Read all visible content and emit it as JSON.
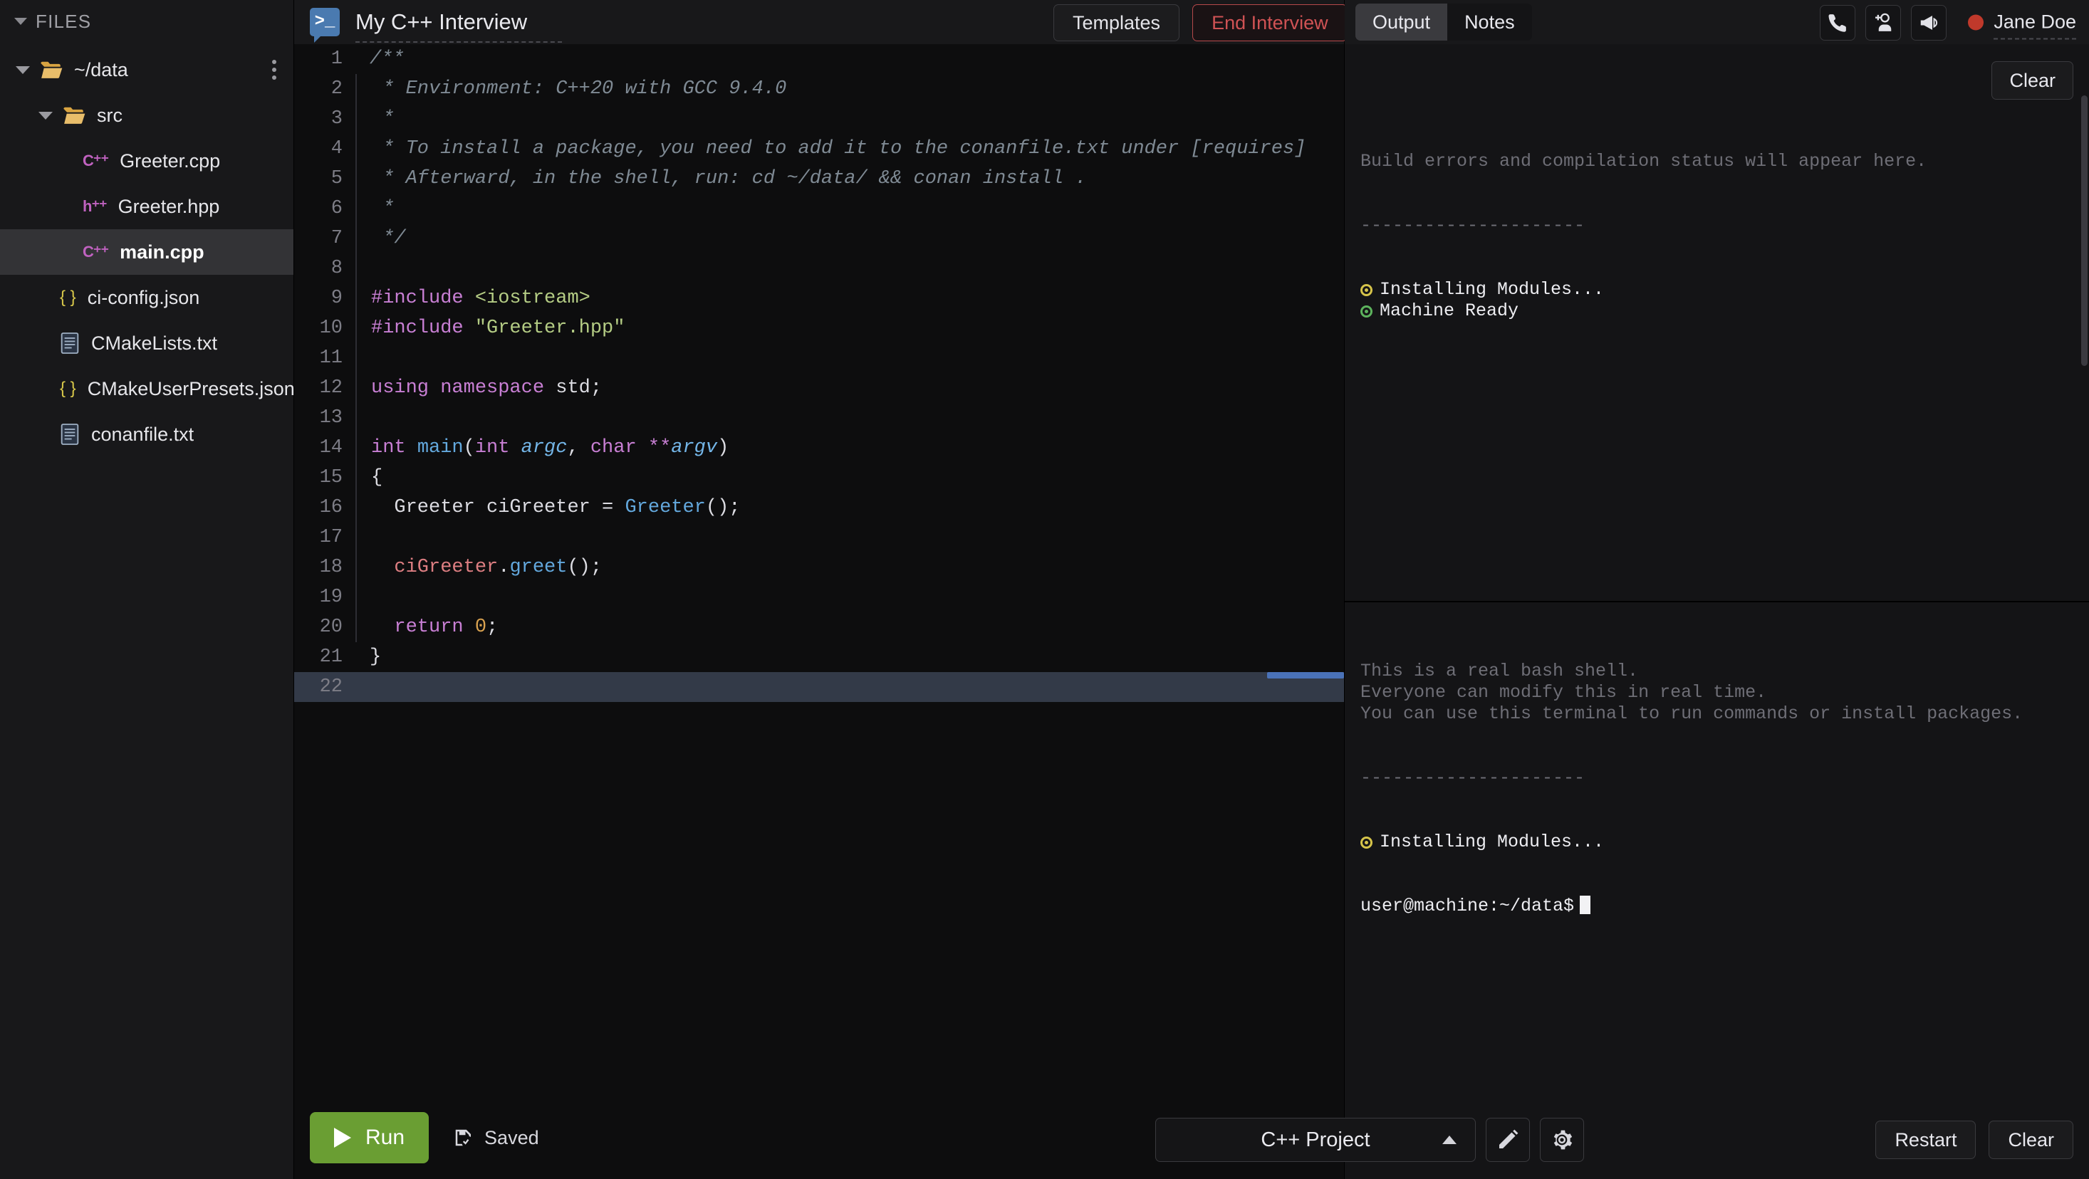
{
  "sidebar": {
    "header": "FILES",
    "tree": [
      {
        "label": "~/data",
        "icon": "folder-open-icon",
        "depth": 0,
        "expandable": true,
        "selected": false,
        "has_menu": true
      },
      {
        "label": "src",
        "icon": "folder-open-icon",
        "depth": 1,
        "expandable": true,
        "selected": false,
        "has_menu": false
      },
      {
        "label": "Greeter.cpp",
        "icon": "cpp-file-icon",
        "depth": 2,
        "expandable": false,
        "selected": false,
        "has_menu": false
      },
      {
        "label": "Greeter.hpp",
        "icon": "hpp-file-icon",
        "depth": 2,
        "expandable": false,
        "selected": false,
        "has_menu": false
      },
      {
        "label": "main.cpp",
        "icon": "cpp-file-icon",
        "depth": 2,
        "expandable": false,
        "selected": true,
        "has_menu": false
      },
      {
        "label": "ci-config.json",
        "icon": "json-file-icon",
        "depth": 1,
        "expandable": false,
        "selected": false,
        "has_menu": false
      },
      {
        "label": "CMakeLists.txt",
        "icon": "text-file-icon",
        "depth": 1,
        "expandable": false,
        "selected": false,
        "has_menu": false
      },
      {
        "label": "CMakeUserPresets.json",
        "icon": "json-file-icon",
        "depth": 1,
        "expandable": false,
        "selected": false,
        "has_menu": false
      },
      {
        "label": "conanfile.txt",
        "icon": "text-file-icon",
        "depth": 1,
        "expandable": false,
        "selected": false,
        "has_menu": false
      }
    ]
  },
  "topbar": {
    "logo_glyph": ">_",
    "pad_title": "My C++ Interview",
    "templates_label": "Templates",
    "end_interview_label": "End Interview"
  },
  "editor": {
    "language": "cpp",
    "current_line": 22,
    "lines": [
      {
        "n": 1,
        "tokens": [
          {
            "t": "/**",
            "c": "cm"
          }
        ]
      },
      {
        "n": 2,
        "tokens": [
          {
            "t": " * Environment: C++20 with GCC 9.4.0",
            "c": "cm"
          }
        ]
      },
      {
        "n": 3,
        "tokens": [
          {
            "t": " *",
            "c": "cm"
          }
        ]
      },
      {
        "n": 4,
        "tokens": [
          {
            "t": " * To install a package, you need to add it to the conanfile.txt under [requires]",
            "c": "cm"
          }
        ]
      },
      {
        "n": 5,
        "tokens": [
          {
            "t": " * Afterward, in the shell, run: cd ~/data/ && conan install .",
            "c": "cm"
          }
        ]
      },
      {
        "n": 6,
        "tokens": [
          {
            "t": " *",
            "c": "cm"
          }
        ]
      },
      {
        "n": 7,
        "tokens": [
          {
            "t": " */",
            "c": "cm"
          }
        ]
      },
      {
        "n": 8,
        "tokens": []
      },
      {
        "n": 9,
        "tokens": [
          {
            "t": "#include",
            "c": "pre"
          },
          {
            "t": " ",
            "c": "pl"
          },
          {
            "t": "<iostream>",
            "c": "str"
          }
        ]
      },
      {
        "n": 10,
        "tokens": [
          {
            "t": "#include",
            "c": "pre"
          },
          {
            "t": " ",
            "c": "pl"
          },
          {
            "t": "\"Greeter.hpp\"",
            "c": "str"
          }
        ]
      },
      {
        "n": 11,
        "tokens": []
      },
      {
        "n": 12,
        "tokens": [
          {
            "t": "using namespace",
            "c": "kw"
          },
          {
            "t": " std;",
            "c": "pl"
          }
        ]
      },
      {
        "n": 13,
        "tokens": []
      },
      {
        "n": 14,
        "tokens": [
          {
            "t": "int",
            "c": "kw"
          },
          {
            "t": " ",
            "c": "pl"
          },
          {
            "t": "main",
            "c": "fn"
          },
          {
            "t": "(",
            "c": "pl"
          },
          {
            "t": "int",
            "c": "kw"
          },
          {
            "t": " ",
            "c": "pl"
          },
          {
            "t": "argc",
            "c": "par"
          },
          {
            "t": ", ",
            "c": "pl"
          },
          {
            "t": "char",
            "c": "kw"
          },
          {
            "t": " ",
            "c": "pl"
          },
          {
            "t": "**",
            "c": "kw"
          },
          {
            "t": "argv",
            "c": "par"
          },
          {
            "t": ")",
            "c": "pl"
          }
        ]
      },
      {
        "n": 15,
        "tokens": [
          {
            "t": "{",
            "c": "pl"
          }
        ]
      },
      {
        "n": 16,
        "tokens": [
          {
            "t": "  Greeter ciGreeter = ",
            "c": "pl"
          },
          {
            "t": "Greeter",
            "c": "fn"
          },
          {
            "t": "();",
            "c": "pl"
          }
        ]
      },
      {
        "n": 17,
        "tokens": []
      },
      {
        "n": 18,
        "tokens": [
          {
            "t": "  ",
            "c": "pl"
          },
          {
            "t": "ciGreeter",
            "c": "var"
          },
          {
            "t": ".",
            "c": "pl"
          },
          {
            "t": "greet",
            "c": "fn"
          },
          {
            "t": "();",
            "c": "pl"
          }
        ]
      },
      {
        "n": 19,
        "tokens": []
      },
      {
        "n": 20,
        "tokens": [
          {
            "t": "  ",
            "c": "pl"
          },
          {
            "t": "return",
            "c": "kw"
          },
          {
            "t": " ",
            "c": "pl"
          },
          {
            "t": "0",
            "c": "num"
          },
          {
            "t": ";",
            "c": "pl"
          }
        ]
      },
      {
        "n": 21,
        "tokens": [
          {
            "t": "}",
            "c": "pl"
          }
        ]
      },
      {
        "n": 22,
        "tokens": []
      }
    ]
  },
  "bottombar": {
    "run_label": "Run",
    "saved_label": "Saved",
    "project_label": "C++ Project",
    "edit_icon": "pencil-icon",
    "settings_icon": "gear-icon"
  },
  "rightpanel": {
    "tabs": [
      {
        "label": "Output",
        "active": true
      },
      {
        "label": "Notes",
        "active": false
      }
    ],
    "icons": [
      {
        "name": "phone-icon"
      },
      {
        "name": "add-person-icon"
      },
      {
        "name": "megaphone-icon"
      }
    ],
    "user_name": "Jane Doe",
    "user_status_color": "#c0392b",
    "clear_top_label": "Clear",
    "output": {
      "placeholder": "Build errors and compilation status will appear here.",
      "divider": "---------------------",
      "status_lines": [
        {
          "text": "Installing Modules...",
          "dot": "yellow"
        },
        {
          "text": "Machine Ready",
          "dot": "green"
        }
      ]
    },
    "terminal": {
      "intro_lines": [
        "This is a real bash shell.",
        "Everyone can modify this in real time.",
        "You can use this terminal to run commands or install packages."
      ],
      "divider": "---------------------",
      "status_lines": [
        {
          "text": "Installing Modules...",
          "dot": "yellow"
        }
      ],
      "prompt": "user@machine:~/data$"
    },
    "restart_label": "Restart",
    "clear_bottom_label": "Clear"
  },
  "colors": {
    "accent_run": "#6a9e33",
    "danger": "#cf5254",
    "logo_blue": "#4a7ab0",
    "selection": "#333a48"
  }
}
